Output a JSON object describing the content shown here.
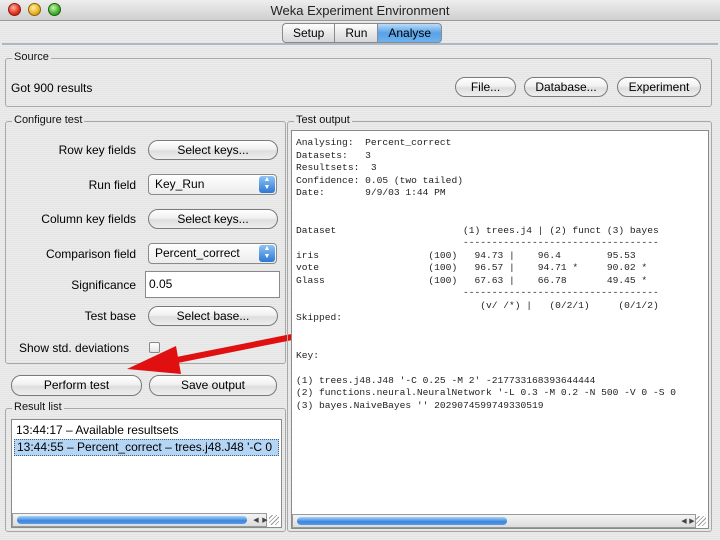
{
  "window": {
    "title": "Weka Experiment Environment"
  },
  "tabs": [
    {
      "label": "Setup",
      "active": false
    },
    {
      "label": "Run",
      "active": false
    },
    {
      "label": "Analyse",
      "active": true
    }
  ],
  "source": {
    "legend": "Source",
    "status": "Got 900 results",
    "file_button": "File...",
    "database_button": "Database...",
    "experiment_button": "Experiment"
  },
  "configure": {
    "legend": "Configure test",
    "row_key_label": "Row key fields",
    "row_key_button": "Select keys...",
    "run_field_label": "Run field",
    "run_field_value": "Key_Run",
    "column_key_label": "Column key fields",
    "column_key_button": "Select keys...",
    "comparison_label": "Comparison field",
    "comparison_value": "Percent_correct",
    "significance_label": "Significance",
    "significance_value": "0.05",
    "test_base_label": "Test base",
    "test_base_button": "Select base...",
    "show_std_label": "Show std. deviations",
    "show_std_checked": false
  },
  "actions": {
    "perform_test": "Perform test",
    "save_output": "Save output"
  },
  "result_list": {
    "legend": "Result list",
    "items": [
      {
        "text": "13:44:17 – Available resultsets",
        "selected": false
      },
      {
        "text": "13:44:55 – Percent_correct – trees.j48.J48 '-C 0",
        "selected": true
      }
    ]
  },
  "test_output": {
    "legend": "Test output",
    "text": "Analysing:  Percent_correct\nDatasets:   3\nResultsets:  3\nConfidence: 0.05 (two tailed)\nDate:       9/9/03 1:44 PM\n\n\nDataset                      (1) trees.j4 | (2) funct (3) bayes\n                             ----------------------------------\niris                   (100)   94.73 |    96.4        95.53\nvote                   (100)   96.57 |    94.71 *     90.02 *\nGlass                  (100)   67.63 |    66.78       49.45 *\n                             ----------------------------------\n                                (v/ /*) |   (0/2/1)     (0/1/2)\nSkipped:\n\n\nKey:\n\n(1) trees.j48.J48 '-C 0.25 -M 2' -217733168393644444\n(2) functions.neural.NeuralNetwork '-L 0.3 -M 0.2 -N 500 -V 0 -S 0\n(3) bayes.NaiveBayes '' 2029074599749330519"
  },
  "annotation": {
    "arrow_color": "#e01010"
  },
  "colors": {
    "tab_active": "#5aa2e6",
    "selection": "#b5d5f5"
  }
}
